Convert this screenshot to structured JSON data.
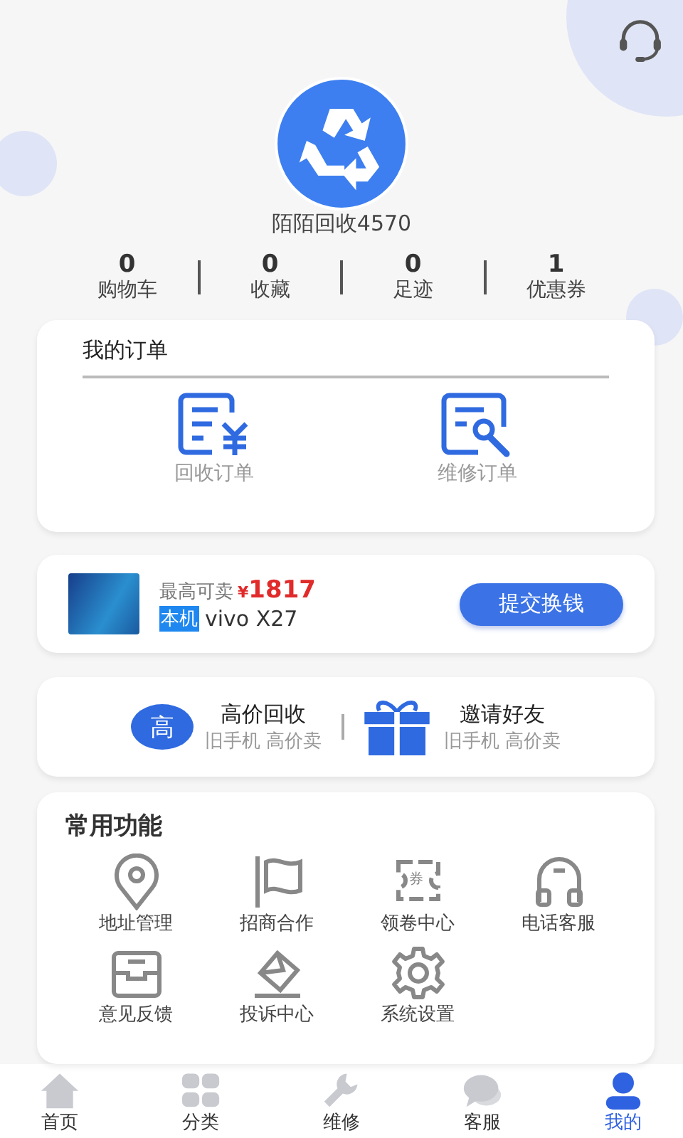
{
  "header": {
    "username": "陌陌回收4570"
  },
  "stats": [
    {
      "value": "0",
      "label": "购物车"
    },
    {
      "value": "0",
      "label": "收藏"
    },
    {
      "value": "0",
      "label": "足迹"
    },
    {
      "value": "1",
      "label": "优惠券"
    }
  ],
  "orders": {
    "title": "我的订单",
    "items": [
      {
        "label": "回收订单"
      },
      {
        "label": "维修订单"
      }
    ]
  },
  "offer": {
    "prefix": "最高可卖",
    "currency": "¥",
    "price": "1817",
    "tag": "本机",
    "model": "vivo X27",
    "button": "提交换钱"
  },
  "promos": [
    {
      "badge": "高",
      "title": "高价回收",
      "subtitle": "旧手机 高价卖"
    },
    {
      "title": "邀请好友",
      "subtitle": "旧手机 高价卖"
    }
  ],
  "functions": {
    "title": "常用功能",
    "items": [
      {
        "label": "地址管理"
      },
      {
        "label": "招商合作"
      },
      {
        "label": "领卷中心",
        "icon_text": "券"
      },
      {
        "label": "电话客服"
      },
      {
        "label": "意见反馈"
      },
      {
        "label": "投诉中心"
      },
      {
        "label": "系统设置"
      }
    ]
  },
  "tabs": [
    {
      "label": "首页",
      "selected": false
    },
    {
      "label": "分类",
      "selected": false
    },
    {
      "label": "维修",
      "selected": false
    },
    {
      "label": "客服",
      "selected": false
    },
    {
      "label": "我的",
      "selected": true
    }
  ]
}
